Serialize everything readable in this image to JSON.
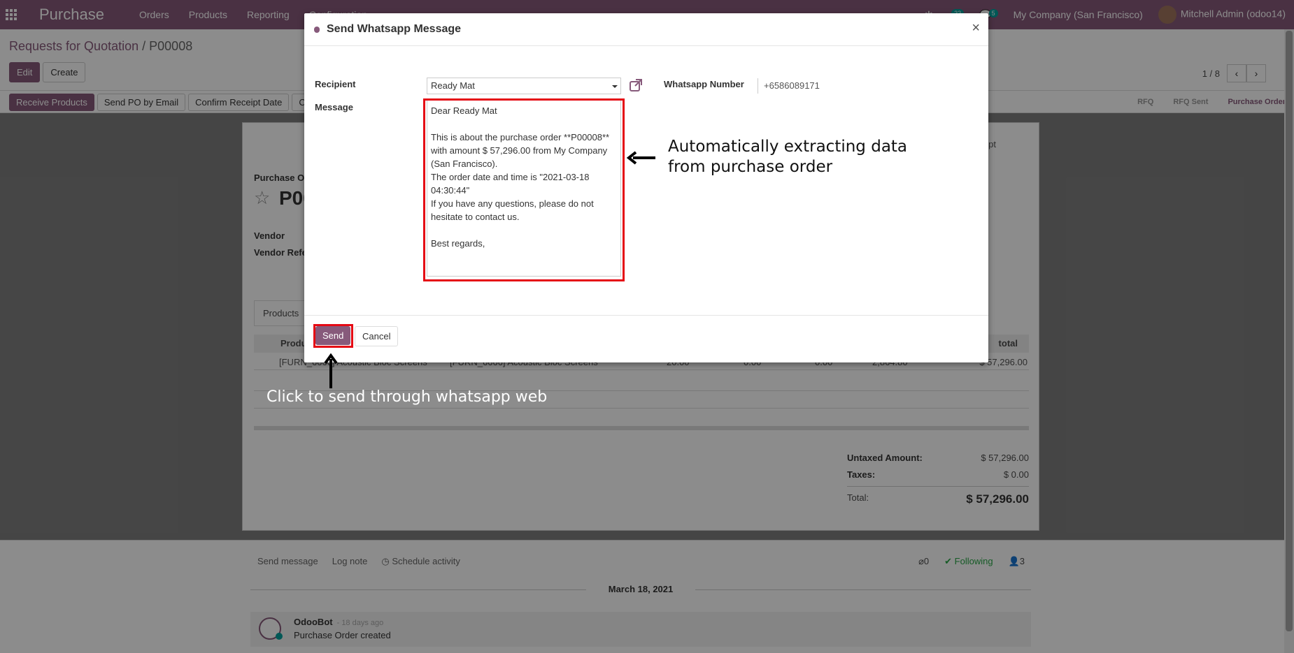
{
  "navbar": {
    "brand": "Purchase",
    "menu": [
      "Orders",
      "Products",
      "Reporting",
      "Configuration"
    ],
    "activity_count": "22",
    "message_count": "5",
    "company": "My Company (San Francisco)",
    "user": "Mitchell Admin (odoo14)"
  },
  "breadcrumb": {
    "parent": "Requests for Quotation",
    "separator": "/",
    "current": "P00008"
  },
  "control": {
    "edit_label": "Edit",
    "create_label": "Create",
    "pager": "1 / 8"
  },
  "statusbar": {
    "buttons": [
      "Receive Products",
      "Send PO by Email",
      "Confirm Receipt Date",
      "C"
    ],
    "stages": [
      "RFQ",
      "RFQ Sent",
      "Purchase Order"
    ],
    "active_stage": "Purchase Order"
  },
  "sheet": {
    "receipt_label": "eipt",
    "po_label": "Purchase O",
    "po_number": "P00",
    "vendor_label": "Vendor",
    "vendor_ref_label": "Vendor Refe",
    "tab_products": "Products",
    "col_product": "Produ",
    "col_total": "total",
    "row_product": "[FURN_6666] Acoustic Bloc Screens",
    "row_description": "[FURN_6666] Acoustic Bloc Screens",
    "row_qty": "20.00",
    "row_received": "0.00",
    "row_billed": "0.00",
    "row_unit_price": "2,864.80",
    "row_total": "$ 57,296.00",
    "untaxed_label": "Untaxed Amount:",
    "untaxed_value": "$ 57,296.00",
    "taxes_label": "Taxes:",
    "taxes_value": "$ 0.00",
    "total_label": "Total:",
    "total_value": "$ 57,296.00"
  },
  "chatter": {
    "send_message": "Send message",
    "log_note": "Log note",
    "schedule_activity": "Schedule activity",
    "attachments": "0",
    "following": "Following",
    "followers": "3",
    "date": "March 18, 2021",
    "author": "OdooBot",
    "time_ago": "- 18 days ago",
    "body": "Purchase Order created"
  },
  "modal": {
    "title": "Send Whatsapp Message",
    "recipient_label": "Recipient",
    "recipient_value": "Ready Mat",
    "message_label": "Message",
    "whatsapp_label": "Whatsapp Number",
    "whatsapp_value": "+6586089171",
    "message_text": "Dear Ready Mat\n\nThis is about the purchase order **P00008** with amount $ 57,296.00 from My Company (San Francisco).\nThe order date and time is \"2021-03-18 04:30:44\"\nIf you have any questions, please do not hesitate to contact us.\n\nBest regards,",
    "send_label": "Send",
    "cancel_label": "Cancel"
  },
  "annotations": {
    "extract": "Automatically extracting data from purchase order",
    "send_hint": "Click to send through whatsapp web"
  }
}
